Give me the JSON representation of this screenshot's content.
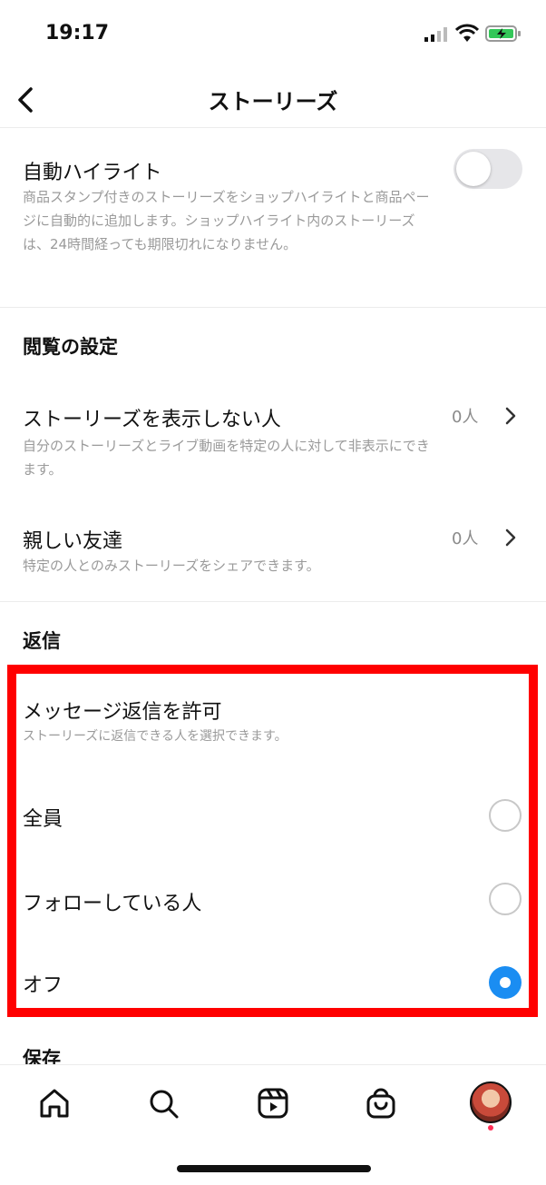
{
  "status_bar": {
    "time": "19:17"
  },
  "nav": {
    "title": "ストーリーズ"
  },
  "auto_highlight": {
    "title": "自動ハイライト",
    "description": "商品スタンプ付きのストーリーズをショップハイライトと商品ページに自動的に追加します。ショップハイライト内のストーリーズは、24時間経っても期限切れになりません。",
    "enabled": false
  },
  "viewing": {
    "header": "閲覧の設定",
    "hide_story": {
      "title": "ストーリーズを表示しない人",
      "description": "自分のストーリーズとライブ動画を特定の人に対して非表示にできます。",
      "value": "0人"
    },
    "close_friends": {
      "title": "親しい友達",
      "description": "特定の人とのみストーリーズをシェアできます。",
      "value": "0人"
    }
  },
  "replies": {
    "header": "返信",
    "allow_title": "メッセージ返信を許可",
    "allow_description": "ストーリーズに返信できる人を選択できます。",
    "options": [
      {
        "label": "全員",
        "selected": false
      },
      {
        "label": "フォローしている人",
        "selected": false
      },
      {
        "label": "オフ",
        "selected": true
      }
    ]
  },
  "save": {
    "header": "保存"
  },
  "tab_bar": {
    "icons": [
      "home-icon",
      "search-icon",
      "reels-icon",
      "shop-icon",
      "profile-avatar"
    ]
  },
  "colors": {
    "accent": "#1a8df2",
    "highlight": "#ff0000"
  }
}
